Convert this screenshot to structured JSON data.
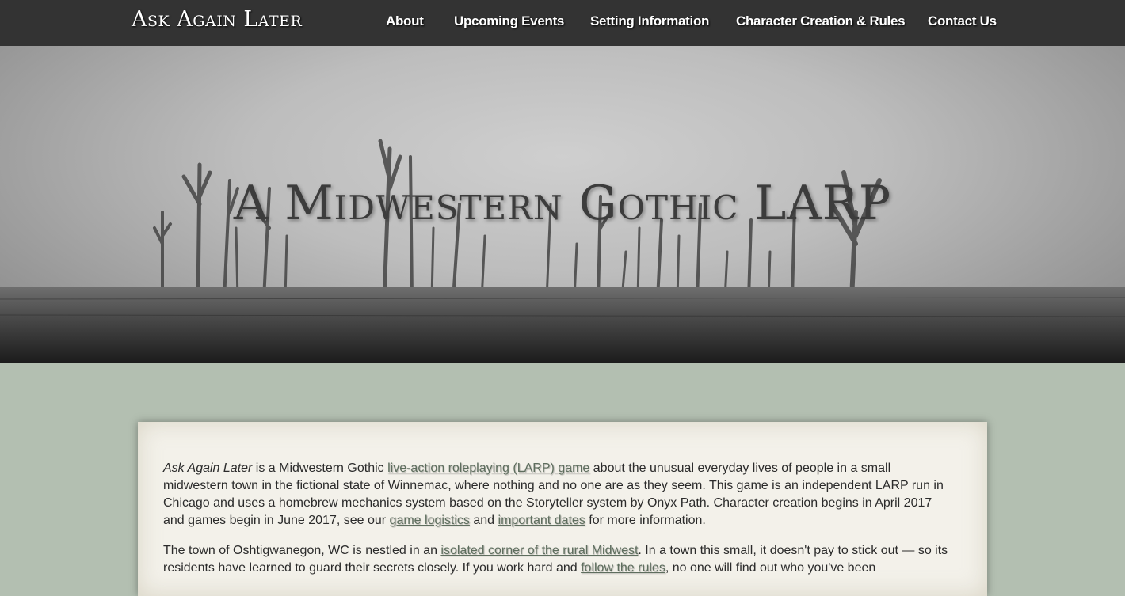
{
  "brand": "Ask Again Later",
  "nav": [
    {
      "label": "About"
    },
    {
      "label": "Upcoming Events"
    },
    {
      "label": "Setting Information"
    },
    {
      "label": "Character Creation & Rules"
    },
    {
      "label": "Contact Us"
    }
  ],
  "hero": {
    "title": "A Midwestern Gothic LARP"
  },
  "content": {
    "p1": {
      "title_italic": "Ask Again Later",
      "t1": " is a Midwestern Gothic ",
      "link1": "live-action roleplaying (LARP) game",
      "t2": " about the unusual everyday lives of people in a small midwestern town in the fictional state of Winnemac, where nothing and no one are as they seem. This game is an independent LARP run in Chicago and uses a homebrew mechanics system based on the Storyteller system by Onyx Path. Character creation begins in April 2017 and games begin in June 2017, see our ",
      "link2": "game logistics",
      "t3": " and ",
      "link3": "important dates",
      "t4": " for more information."
    },
    "p2": {
      "t1": "The town of Oshtigwanegon, WC is nestled in an ",
      "link1": "isolated corner of the rural Midwest",
      "t2": ". In a town this small, it doesn't pay to stick out — so its residents have learned to guard their secrets closely. If you work hard and ",
      "link2": "follow the rules",
      "t3": ", no one will find out who you've been"
    }
  },
  "colors": {
    "topbar": "#333333",
    "page_bg": "#b3bfb1",
    "card_bg": "#f3f1ea",
    "link": "#5e6e5e"
  }
}
